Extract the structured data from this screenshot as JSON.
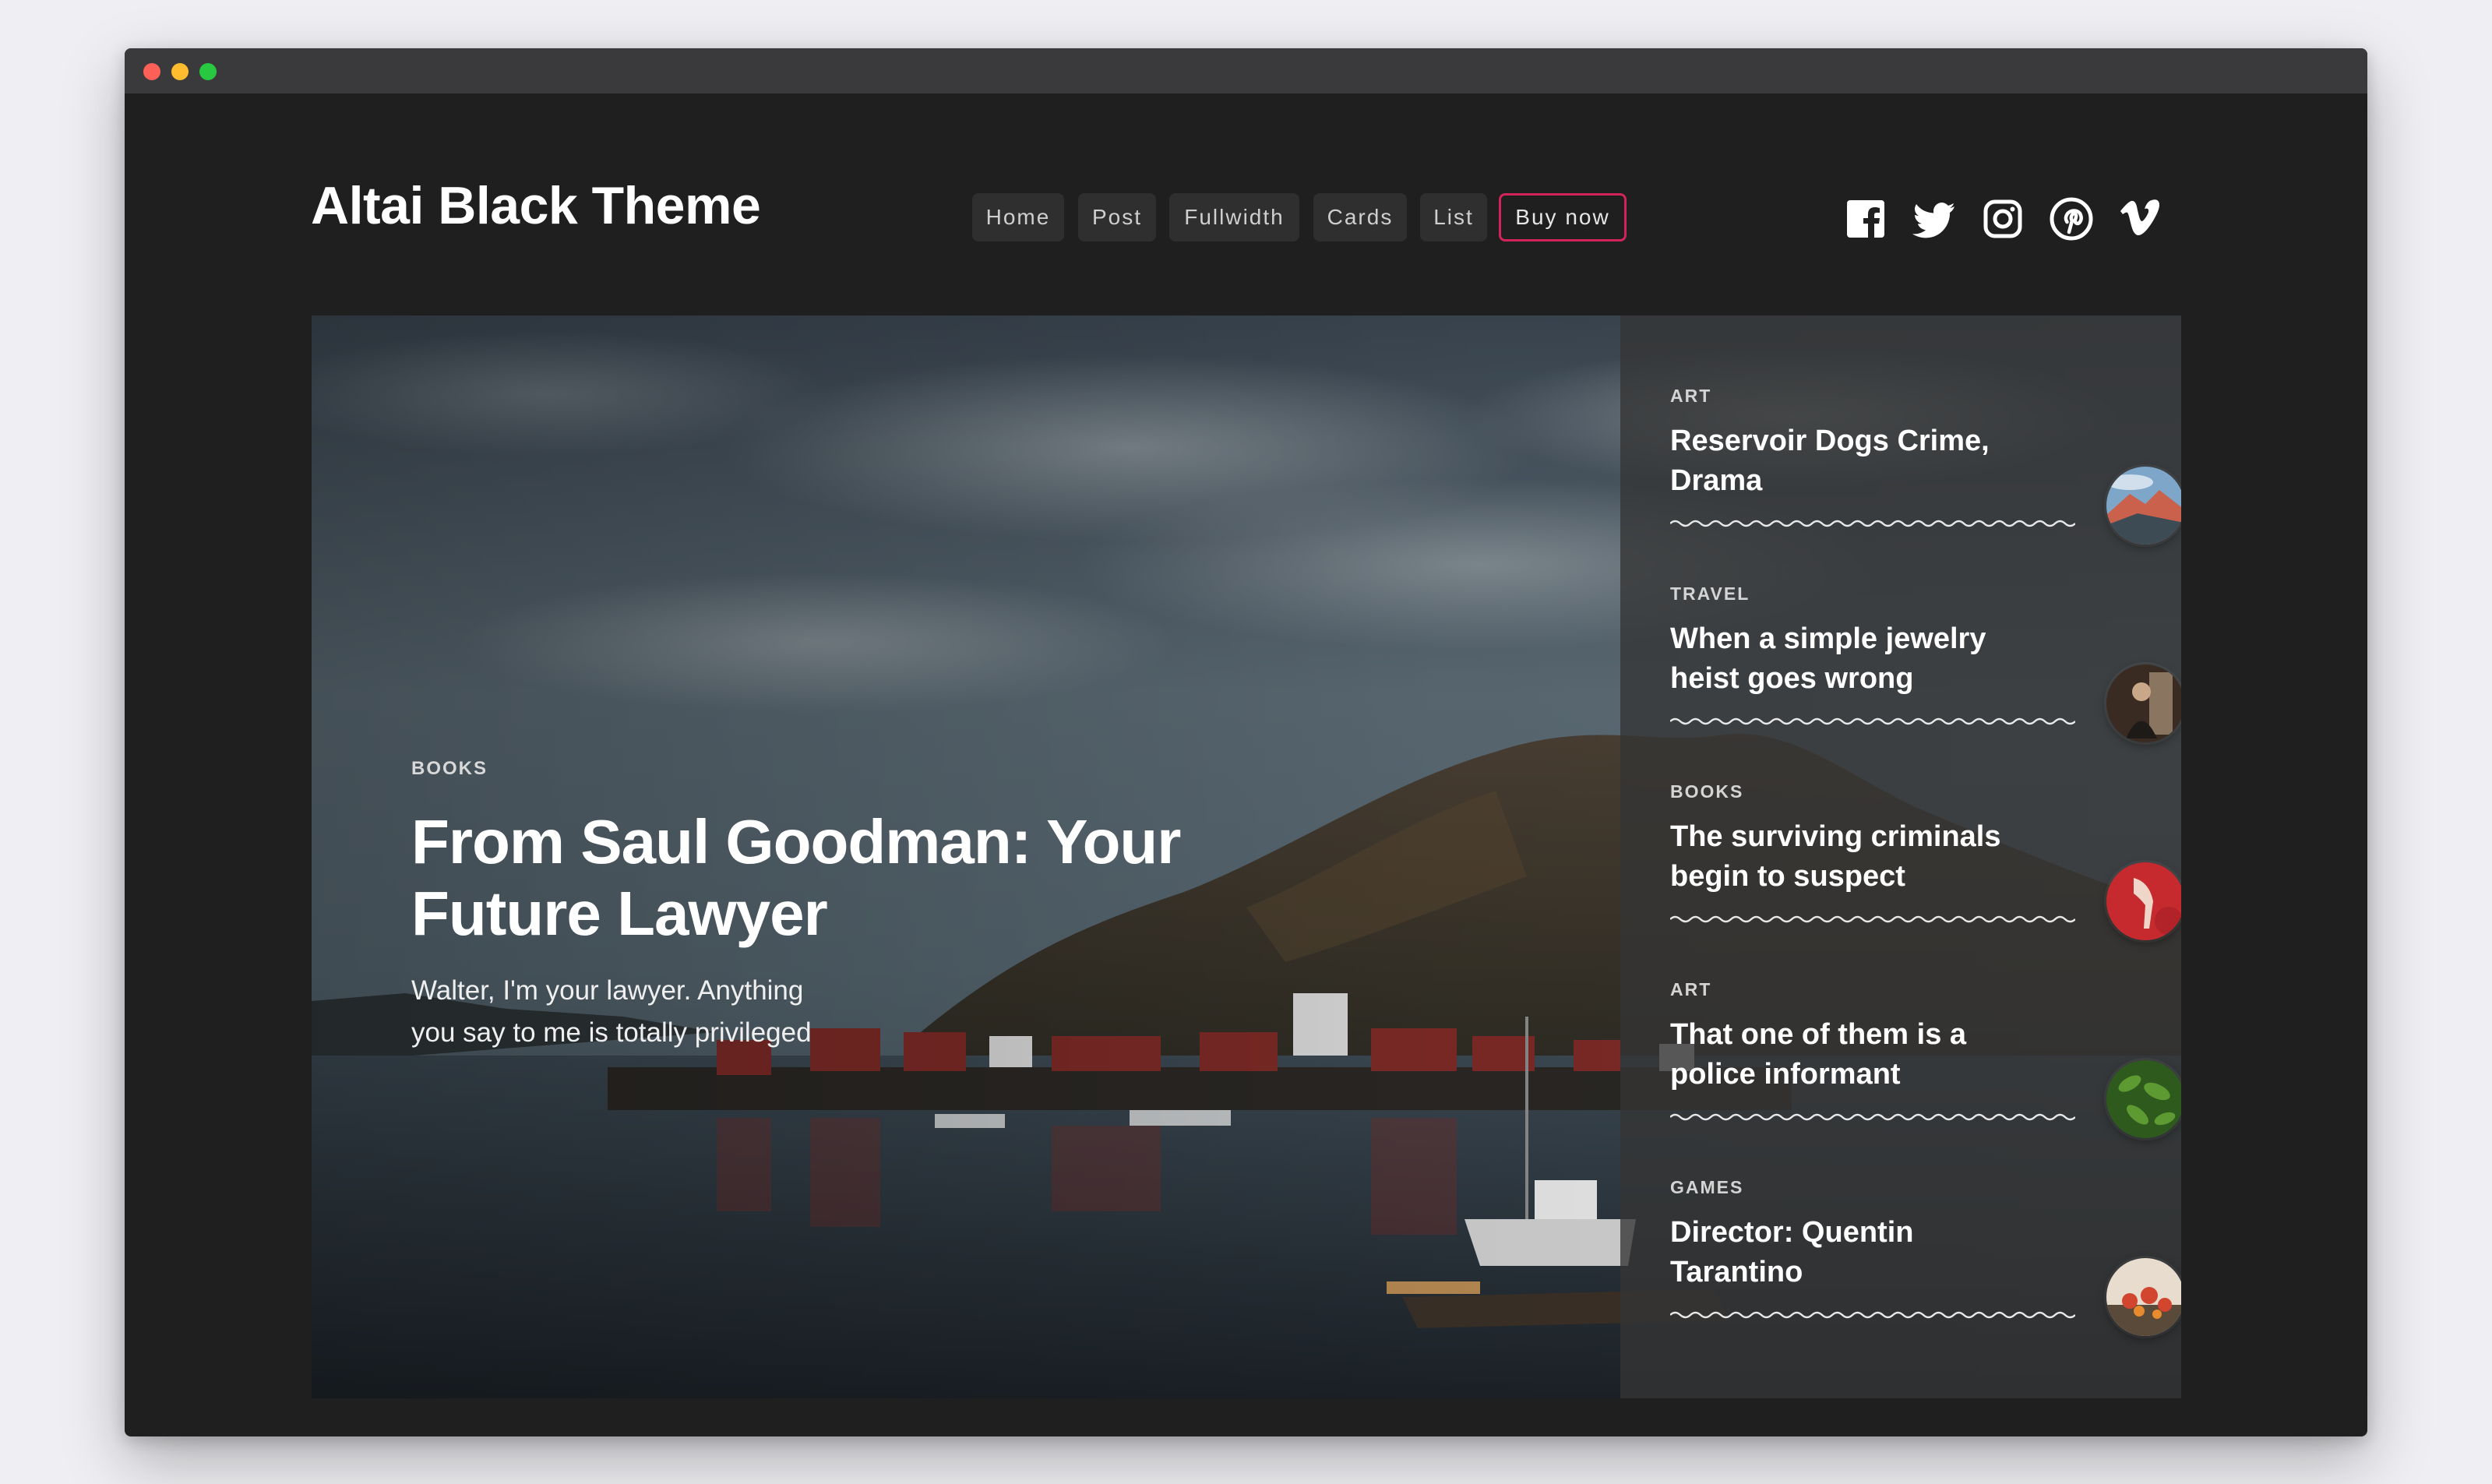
{
  "window": {
    "controls": [
      "close",
      "minimize",
      "maximize"
    ]
  },
  "site": {
    "title": "Altai Black Theme"
  },
  "nav": [
    {
      "label": "Home"
    },
    {
      "label": "Post"
    },
    {
      "label": "Fullwidth"
    },
    {
      "label": "Cards"
    },
    {
      "label": "List"
    },
    {
      "label": "Buy now",
      "accent": "#d0245a"
    }
  ],
  "social": [
    {
      "icon": "facebook-icon"
    },
    {
      "icon": "twitter-icon"
    },
    {
      "icon": "instagram-icon"
    },
    {
      "icon": "pinterest-icon"
    },
    {
      "icon": "vimeo-icon"
    }
  ],
  "featured": {
    "category": "BOOKS",
    "title": "From Saul Goodman: Your Future Lawyer",
    "excerpt": "Walter, I'm your lawyer. Anything you say to me is totally privileged"
  },
  "sidebar": [
    {
      "category": "ART",
      "title": "Reservoir Dogs Crime, Drama",
      "thumb": "mountain-thumbnail"
    },
    {
      "category": "TRAVEL",
      "title": "When a simple jewelry heist goes wrong",
      "thumb": "person-thumbnail"
    },
    {
      "category": "BOOKS",
      "title": "The surviving criminals begin to suspect",
      "thumb": "hand-thumbnail"
    },
    {
      "category": "ART",
      "title": "That one of them is a police informant",
      "thumb": "leaves-thumbnail"
    },
    {
      "category": "GAMES",
      "title": "Director: Quentin Tarantino",
      "thumb": "flowers-thumbnail"
    }
  ],
  "colors": {
    "background": "#1f1f1f",
    "accent": "#d0245a",
    "text": "#ffffff"
  }
}
